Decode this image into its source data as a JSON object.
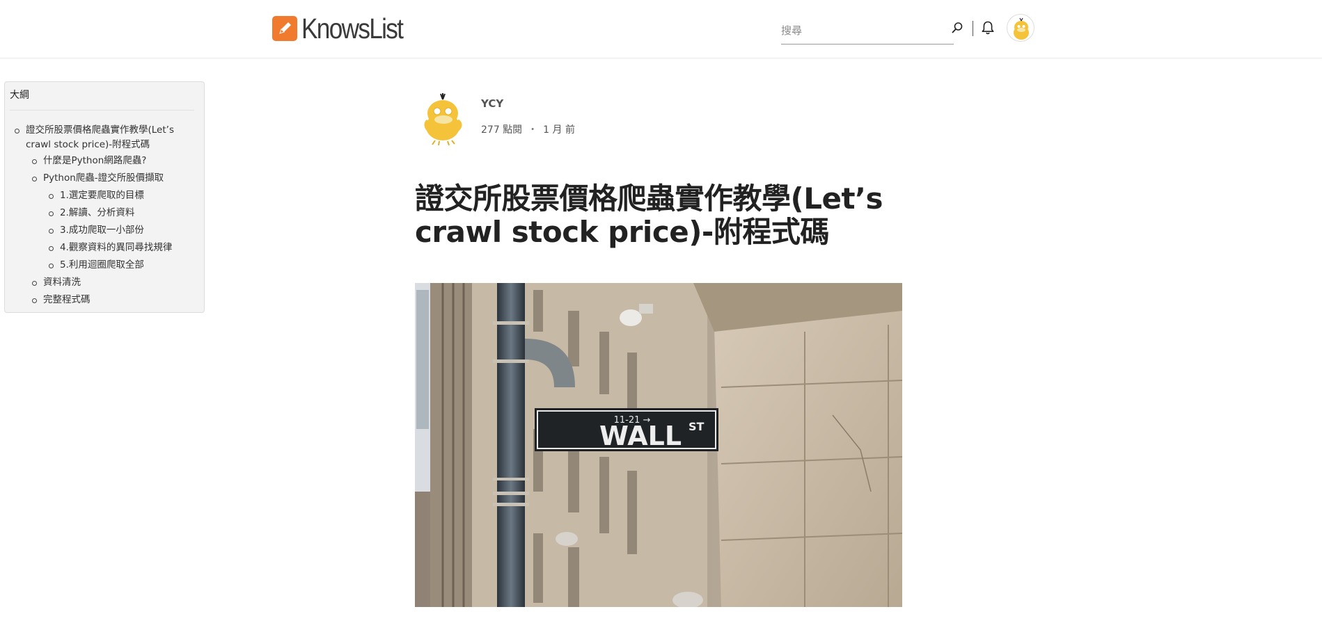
{
  "header": {
    "logo_text": "KnowsList",
    "search_placeholder": "搜尋",
    "brand_color": "#f07a2d"
  },
  "toc": {
    "title": "大綱",
    "items": [
      {
        "label": "證交所股票價格爬蟲實作教學(Let’s crawl stock price)-附程式碼",
        "level": 1
      },
      {
        "label": "什麼是Python網路爬蟲?",
        "level": 2
      },
      {
        "label": "Python爬蟲-證交所股價擷取",
        "level": 2
      },
      {
        "label": "1.選定要爬取的目標",
        "level": 3
      },
      {
        "label": "2.解讀、分析資料",
        "level": 3
      },
      {
        "label": "3.成功爬取一小部份",
        "level": 3
      },
      {
        "label": "4.觀察資料的異同尋找規律",
        "level": 3
      },
      {
        "label": "5.利用迴圈爬取全部",
        "level": 3
      },
      {
        "label": "資料清洗",
        "level": 2
      },
      {
        "label": "完整程式碼",
        "level": 2
      }
    ]
  },
  "article": {
    "author": "YCY",
    "views": "277 點閱",
    "time": "1 月 前",
    "title_line1": "證交所股票價格爬蟲實作教學(Let’s",
    "title_line2": "crawl stock price)-附程式碼",
    "hero_sign_top": "11-21 →",
    "hero_sign_main": "WALL",
    "hero_sign_sup": "ST"
  }
}
